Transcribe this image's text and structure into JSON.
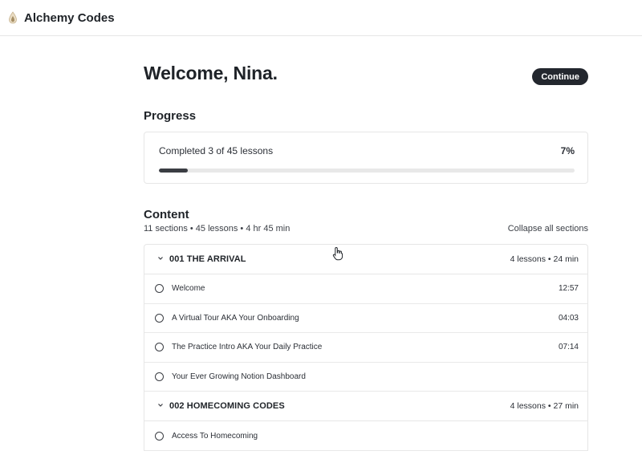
{
  "app": {
    "brand": "Alchemy Codes",
    "logo_icon": "flame-drop-icon"
  },
  "welcome": {
    "title": "Welcome, Nina.",
    "continue_label": "Continue"
  },
  "progress": {
    "title": "Progress",
    "text": "Completed 3 of 45 lessons",
    "percent_label": "7%",
    "percent_value": 7
  },
  "content": {
    "title": "Content",
    "meta": "11 sections • 45 lessons • 4 hr 45 min",
    "collapse_label": "Collapse all sections",
    "sections": [
      {
        "name": "001 THE ARRIVAL",
        "info": "4 lessons • 24 min",
        "lessons": [
          {
            "title": "Welcome",
            "time": "12:57"
          },
          {
            "title": "A Virtual Tour AKA Your Onboarding",
            "time": "04:03"
          },
          {
            "title": "The Practice Intro AKA Your Daily Practice",
            "time": "07:14"
          },
          {
            "title": "Your Ever Growing Notion Dashboard",
            "time": ""
          }
        ]
      },
      {
        "name": "002 HOMECOMING CODES",
        "info": "4 lessons • 27 min",
        "lessons": [
          {
            "title": "Access To Homecoming",
            "time": ""
          }
        ]
      }
    ]
  },
  "colors": {
    "accent_dark": "#23272e",
    "progress_fill": "#3a3d43",
    "progress_track": "#e8e8e8",
    "border": "#e6e6e6"
  }
}
